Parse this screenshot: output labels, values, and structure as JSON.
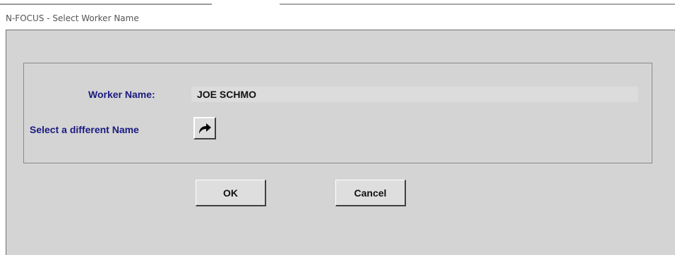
{
  "window": {
    "title": "N-FOCUS - Select Worker Name"
  },
  "form": {
    "worker_name_label": "Worker Name:",
    "worker_name_value": "JOE SCHMO",
    "select_different_label": "Select a different Name"
  },
  "icons": {
    "select_button_icon": "curved-arrow-right-icon"
  },
  "buttons": {
    "ok_label": "OK",
    "cancel_label": "Cancel"
  }
}
